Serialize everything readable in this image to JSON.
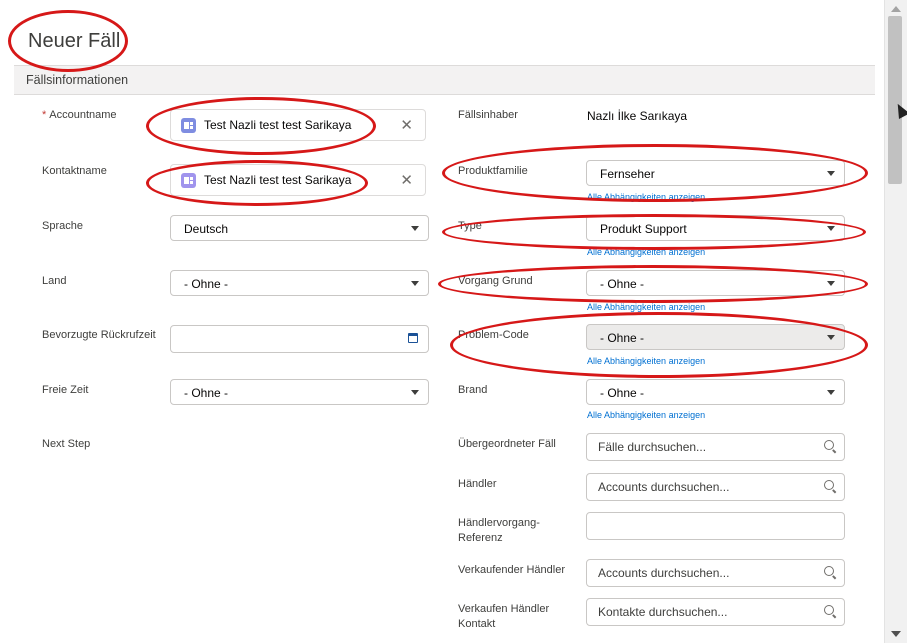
{
  "header": {
    "title": "Neuer Fäll"
  },
  "section": {
    "title": "Fällsinformationen"
  },
  "left": {
    "accountname": {
      "label": "Accountname",
      "value": "Test Nazli test test Sarikaya",
      "required": "*"
    },
    "kontaktname": {
      "label": "Kontaktname",
      "value": "Test Nazli test test Sarikaya"
    },
    "sprache": {
      "label": "Sprache",
      "value": "Deutsch"
    },
    "land": {
      "label": "Land",
      "value": "- Ohne -"
    },
    "rueckruf": {
      "label": "Bevorzugte Rückrufzeit",
      "value": ""
    },
    "freiezeit": {
      "label": "Freie Zeit",
      "value": "- Ohne -"
    },
    "nextstep": {
      "label": "Next Step"
    }
  },
  "right": {
    "inhaber": {
      "label": "Fällsinhaber",
      "value": "Nazlı İlke Sarıkaya"
    },
    "produktfamilie": {
      "label": "Produktfamilie",
      "value": "Fernseher",
      "dep": "Alle Abhängigkeiten anzeigen"
    },
    "type": {
      "label": "Type",
      "value": "Produkt Support",
      "dep": "Alle Abhängigkeiten anzeigen"
    },
    "vorgang": {
      "label": "Vorgang Grund",
      "value": "- Ohne -",
      "dep": "Alle Abhängigkeiten anzeigen"
    },
    "problem": {
      "label": "Problem-Code",
      "value": "- Ohne -",
      "dep": "Alle Abhängigkeiten anzeigen"
    },
    "brand": {
      "label": "Brand",
      "value": "- Ohne -",
      "dep": "Alle Abhängigkeiten anzeigen"
    },
    "uebergeordnet": {
      "label": "Übergeordneter Fäll",
      "placeholder": "Fälle durchsuchen..."
    },
    "haendler": {
      "label": "Händler",
      "placeholder": "Accounts durchsuchen..."
    },
    "haendlerref": {
      "label": "Händlervorgang-Referenz",
      "value": ""
    },
    "verkaufend": {
      "label": "Verkaufender Händler",
      "placeholder": "Accounts durchsuchen..."
    },
    "verkaufenkontakt": {
      "label": "Verkaufen Händler Kontakt",
      "placeholder": "Kontakte durchsuchen..."
    }
  },
  "annotation_color": "#d61818"
}
